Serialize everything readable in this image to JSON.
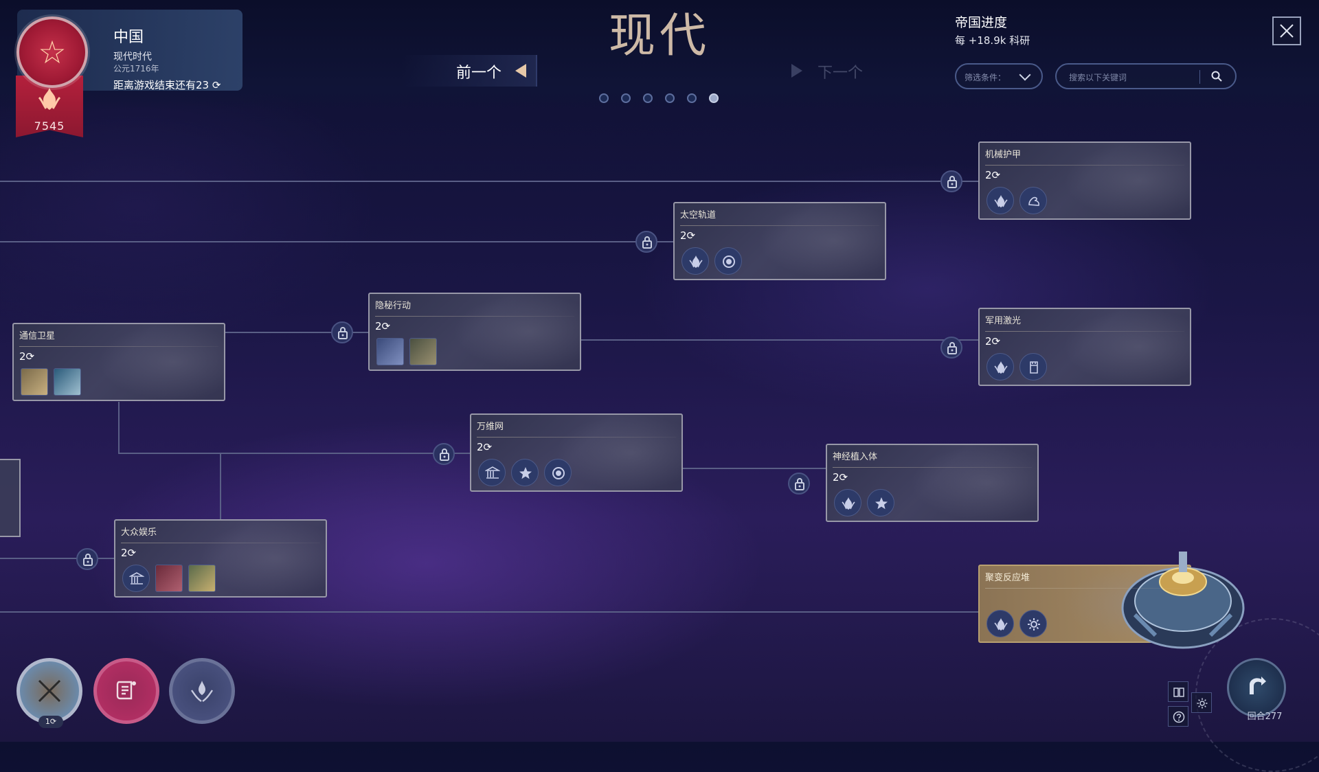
{
  "header": {
    "era_title": "现代",
    "prev_label": "前一个",
    "next_label": "下一个",
    "page_dots": 6,
    "active_dot": 5
  },
  "player": {
    "civ_name": "中国",
    "era": "现代时代",
    "year": "公元1716年",
    "turns_left": "距离游戏结束还有23",
    "score": "7545"
  },
  "empire": {
    "title": "帝国进度",
    "rate": "每 +18.9k 科研"
  },
  "filter": {
    "label": "筛选条件："
  },
  "search": {
    "placeholder": "搜索以下关键词"
  },
  "techs": [
    {
      "name": "机械护甲",
      "cost": "2",
      "icons": [
        "science-icon",
        "arm-icon"
      ]
    },
    {
      "name": "太空轨道",
      "cost": "2",
      "icons": [
        "science-icon",
        "orbit-icon"
      ]
    },
    {
      "name": "隐秘行动",
      "cost": "2",
      "icons": [
        "agent-image",
        "soldier-image"
      ]
    },
    {
      "name": "通信卫星",
      "cost": "2",
      "icons": [
        "building-image",
        "person-image"
      ]
    },
    {
      "name": "军用激光",
      "cost": "2",
      "icons": [
        "science-icon",
        "tower-icon"
      ]
    },
    {
      "name": "万维网",
      "cost": "2",
      "icons": [
        "museum-icon",
        "star-icon",
        "orbit-icon"
      ]
    },
    {
      "name": "神经植入体",
      "cost": "2",
      "icons": [
        "science-icon",
        "star-icon"
      ]
    },
    {
      "name": "大众娱乐",
      "cost": "2",
      "icons": [
        "museum-icon",
        "crowd-image",
        "city-image"
      ]
    },
    {
      "name": "聚变反应堆",
      "cost": "",
      "icons": [
        "science-icon",
        "gear-icon"
      ]
    }
  ],
  "bottom": {
    "action_count": "1",
    "turn_label": "回合277"
  },
  "colors": {
    "accent_gold": "#cdb9a6",
    "banner_red": "#b4203c",
    "card_border": "#9898a8"
  }
}
